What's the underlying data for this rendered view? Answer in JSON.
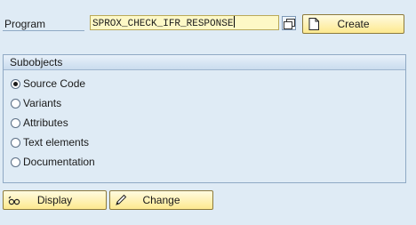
{
  "program": {
    "label": "Program",
    "value": "SPROX_CHECK_IFR_RESPONSE",
    "create_label": "Create"
  },
  "subobjects": {
    "title": "Subobjects",
    "selected": "Source Code",
    "options": [
      "Source Code",
      "Variants",
      "Attributes",
      "Text elements",
      "Documentation"
    ]
  },
  "actions": {
    "display_label": "Display",
    "change_label": "Change"
  },
  "colors": {
    "background": "#dfebf5",
    "input_bg": "#fdf8c6",
    "button_bg": "#fde98f"
  }
}
